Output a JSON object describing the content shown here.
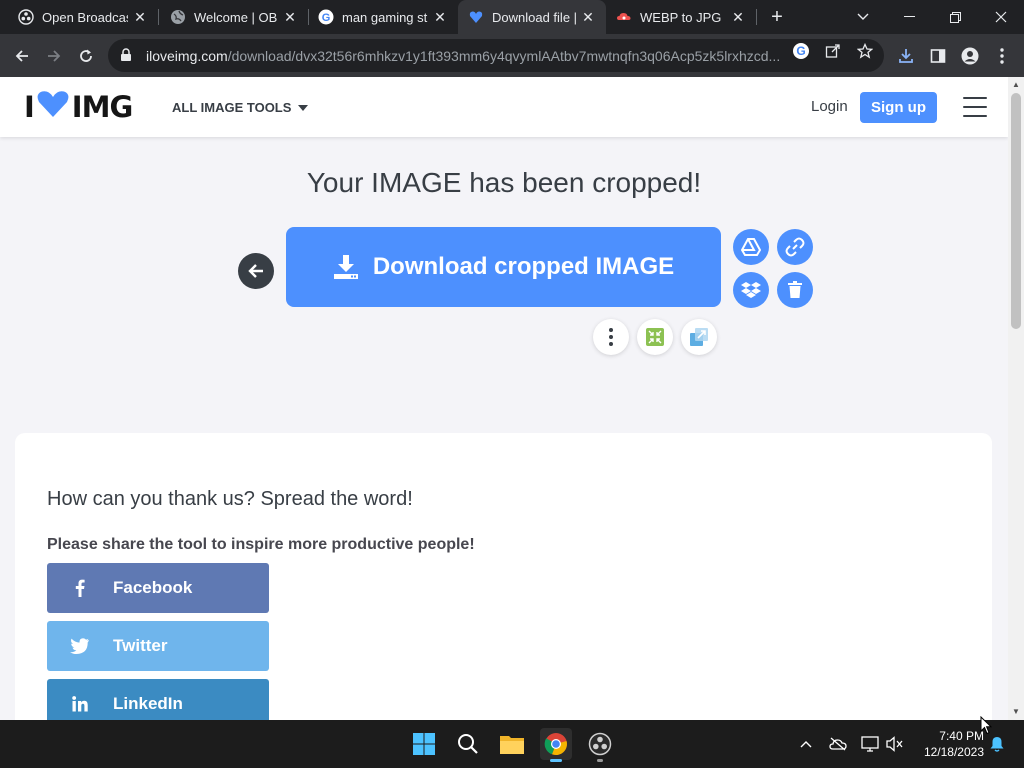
{
  "tabs": [
    {
      "title": "Open Broadcas",
      "icon": "obs-icon"
    },
    {
      "title": "Welcome | OBS",
      "icon": "globe-icon"
    },
    {
      "title": "man gaming st",
      "icon": "google-icon"
    },
    {
      "title": "Download file |",
      "icon": "iloveimg-icon",
      "active": true
    },
    {
      "title": "WEBP to JPG | C",
      "icon": "cloud-icon"
    }
  ],
  "browser": {
    "url_host": "iloveimg.com",
    "url_path": "/download/dvx32t56r6mhkzv1y1ft393mm6y4qvymlAAtbv7mwtnqfn3q06Acp5zk5lrxhzcd..."
  },
  "site": {
    "logo_left": "I",
    "logo_right": "IMG",
    "all_tools": "ALL IMAGE TOOLS",
    "login": "Login",
    "signup": "Sign up",
    "headline": "Your IMAGE has been cropped!",
    "download_label": "Download cropped IMAGE",
    "card_title": "How can you thank us? Spread the word!",
    "card_sub": "Please share the tool to inspire more productive people!",
    "share": [
      {
        "label": "Facebook",
        "icon": "facebook-icon",
        "color": "#5f79b3"
      },
      {
        "label": "Twitter",
        "icon": "twitter-icon",
        "color": "#6fb5ec"
      },
      {
        "label": "LinkedIn",
        "icon": "linkedin-icon",
        "color": "#3b8bc2"
      }
    ]
  },
  "colors": {
    "brand_blue": "#4d90fe",
    "text_dark": "#383e45"
  },
  "taskbar": {
    "time": "7:40 PM",
    "date": "12/18/2023"
  }
}
